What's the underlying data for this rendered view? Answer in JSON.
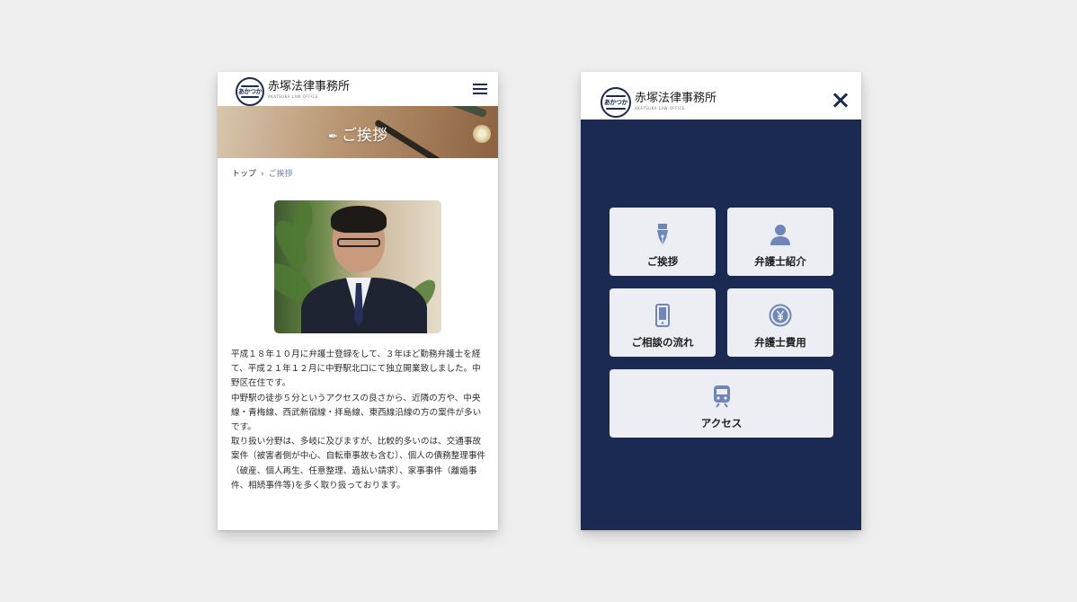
{
  "colors": {
    "navy": "#1b2a52",
    "tile_bg": "#eceef4",
    "icon_blue": "#6e86b9",
    "page_bg": "#efefef"
  },
  "site": {
    "logo_badge": "あかつか",
    "logo_name": "赤塚法律事務所",
    "logo_sub": "AKATSUKA LAW OFFICE"
  },
  "left_screen": {
    "header": {
      "menu_icon": "hamburger-icon"
    },
    "hero": {
      "title": "ご挨拶",
      "icon": "fountain-pen-icon"
    },
    "breadcrumb": {
      "home": "トップ",
      "separator": "›",
      "current": "ご挨拶"
    },
    "greeting": [
      "平成１８年１０月に弁護士登録をして、３年ほど勤務弁護士を経て、平成２１年１２月に中野駅北口にて独立開業致しました。中野区在住です。",
      "中野駅の徒歩５分というアクセスの良さから、近隣の方や、中央線・青梅線、西武新宿線・拝島線、東西線沿線の方の案件が多いです。",
      "取り扱い分野は、多岐に及びますが、比較的多いのは、交通事故案件（被害者側が中心、自転車事故も含む）、個人の債務整理事件（破産、個人再生、任意整理、過払い請求）、家事事件（離婚事件、相続事件等)を多く取り扱っております。"
    ]
  },
  "right_screen": {
    "header": {
      "close_icon": "close-icon"
    },
    "menu": [
      {
        "label": "ご挨拶",
        "icon": "fountain-pen-icon"
      },
      {
        "label": "弁護士紹介",
        "icon": "person-icon"
      },
      {
        "label": "ご相談の流れ",
        "icon": "smartphone-icon"
      },
      {
        "label": "弁護士費用",
        "icon": "yen-coin-icon"
      },
      {
        "label": "アクセス",
        "icon": "train-icon"
      }
    ]
  }
}
